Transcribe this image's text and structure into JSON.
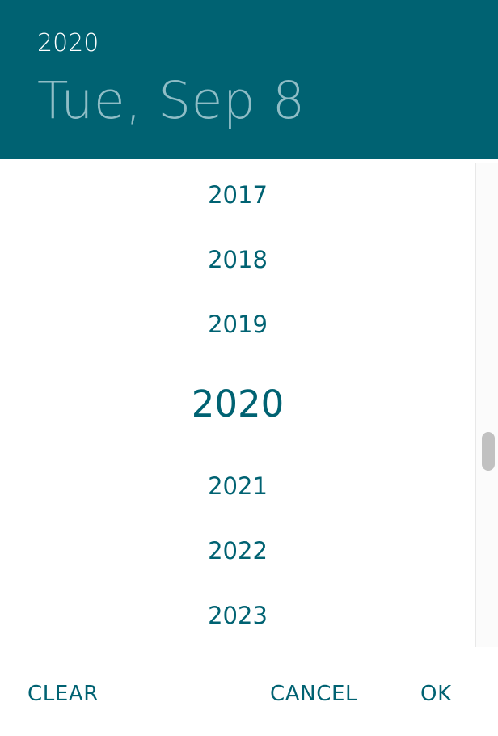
{
  "colors": {
    "header_bg": "#006272",
    "header_date": "#8fbdc6",
    "accent": "#006272"
  },
  "header": {
    "year": "2020",
    "date": "Tue, Sep 8"
  },
  "years": [
    {
      "label": "2017",
      "selected": false
    },
    {
      "label": "2018",
      "selected": false
    },
    {
      "label": "2019",
      "selected": false
    },
    {
      "label": "2020",
      "selected": true
    },
    {
      "label": "2021",
      "selected": false
    },
    {
      "label": "2022",
      "selected": false
    },
    {
      "label": "2023",
      "selected": false
    }
  ],
  "actions": {
    "clear": "CLEAR",
    "cancel": "CANCEL",
    "ok": "OK"
  }
}
